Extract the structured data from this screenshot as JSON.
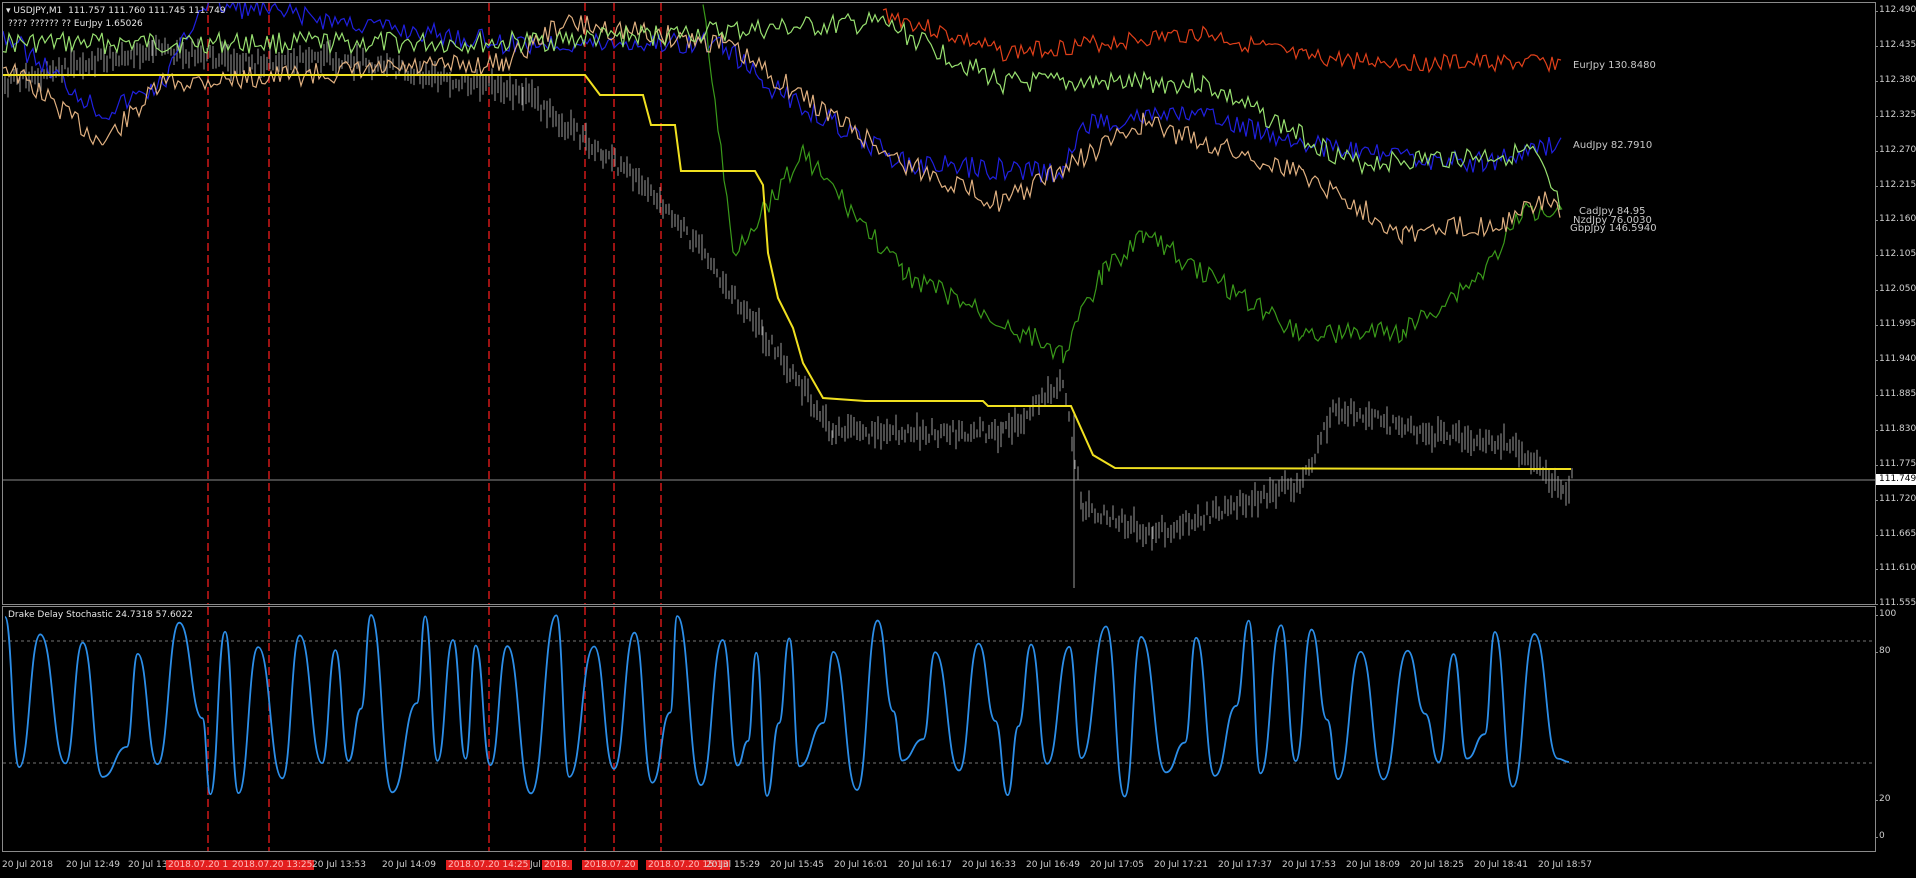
{
  "main_chart": {
    "header_symbol": "USDJPY,M1",
    "header_prices": "111.757 111.760 111.745 111.749",
    "header_sub": "???? ?????? ?? EurJpy 1.65026",
    "current_price": "111.749",
    "series": [
      {
        "name": "EurJpy 130.8480",
        "color": "#e0401a"
      },
      {
        "name": "AudJpy 82.7910",
        "color": "#2020e0"
      },
      {
        "name": "CadJpy 84.95",
        "color": "#3a9a1a"
      },
      {
        "name": "NzdJpy 76.0030",
        "color": "#e0b080"
      },
      {
        "name": "GbpJpy 146.5940",
        "color": "#98e070"
      }
    ],
    "price_axis": [
      "112.490",
      "112.435",
      "112.380",
      "112.325",
      "112.270",
      "112.215",
      "112.160",
      "112.105",
      "112.050",
      "111.995",
      "111.940",
      "111.885",
      "111.830",
      "111.775",
      "111.720",
      "111.665",
      "111.610",
      "111.555"
    ]
  },
  "sub_chart": {
    "title": "Drake Delay Stochastic 24.7318 57.6022",
    "levels": [
      "100",
      "80",
      "20",
      "0"
    ],
    "color": "#2c8ee8"
  },
  "time_axis": [
    {
      "label": "20 Jul 2018",
      "highlight": false
    },
    {
      "label": "20 Jul 12:49",
      "highlight": false
    },
    {
      "label": "20 Jul 13",
      "highlight": false
    },
    {
      "label": "2018.07.20 1",
      "highlight": true
    },
    {
      "label": "2018.07.20 13:25",
      "highlight": true
    },
    {
      "label": "20 Jul 13:53",
      "highlight": false
    },
    {
      "label": "20 Jul 14:09",
      "highlight": false
    },
    {
      "label": "2018.07.20 14:25",
      "highlight": true
    },
    {
      "label": "Jul",
      "highlight": false
    },
    {
      "label": "2018.",
      "highlight": true
    },
    {
      "label": "2018.07.20",
      "highlight": true
    },
    {
      "label": "2018.07.20 15:13",
      "highlight": true
    },
    {
      "label": "20 Jul 15:29",
      "highlight": false
    },
    {
      "label": "20 Jul 15:45",
      "highlight": false
    },
    {
      "label": "20 Jul 16:01",
      "highlight": false
    },
    {
      "label": "20 Jul 16:17",
      "highlight": false
    },
    {
      "label": "20 Jul 16:33",
      "highlight": false
    },
    {
      "label": "20 Jul 16:49",
      "highlight": false
    },
    {
      "label": "20 Jul 17:05",
      "highlight": false
    },
    {
      "label": "20 Jul 17:21",
      "highlight": false
    },
    {
      "label": "20 Jul 17:37",
      "highlight": false
    },
    {
      "label": "20 Jul 17:53",
      "highlight": false
    },
    {
      "label": "20 Jul 18:09",
      "highlight": false
    },
    {
      "label": "20 Jul 18:25",
      "highlight": false
    },
    {
      "label": "20 Jul 18:41",
      "highlight": false
    },
    {
      "label": "20 Jul 18:57",
      "highlight": false
    }
  ]
}
